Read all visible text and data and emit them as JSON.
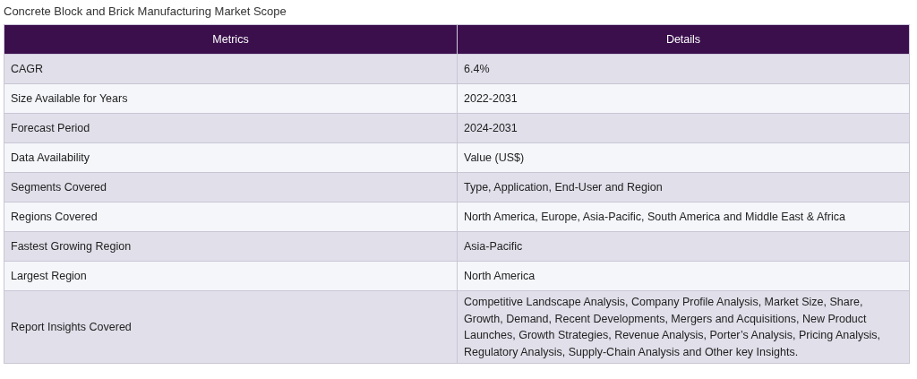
{
  "caption": "Concrete Block and Brick Manufacturing Market Scope",
  "table": {
    "columns": [
      "Metrics",
      "Details"
    ],
    "rows": [
      [
        "CAGR",
        "6.4%"
      ],
      [
        "Size Available for Years",
        "2022-2031"
      ],
      [
        "Forecast Period",
        "2024-2031"
      ],
      [
        "Data Availability",
        "Value (US$)"
      ],
      [
        "Segments Covered",
        "Type, Application, End-User and Region"
      ],
      [
        "Regions Covered",
        "North America, Europe, Asia-Pacific, South America and Middle East & Africa"
      ],
      [
        "Fastest Growing Region",
        "Asia-Pacific"
      ],
      [
        "Largest Region",
        "North America"
      ],
      [
        "Report Insights Covered",
        "Competitive Landscape Analysis, Company Profile Analysis, Market Size, Share, Growth, Demand, Recent Developments, Mergers and Acquisitions, New Product Launches, Growth Strategies, Revenue Analysis, Porter’s Analysis, Pricing Analysis, Regulatory Analysis, Supply-Chain Analysis and Other key Insights."
      ]
    ]
  }
}
